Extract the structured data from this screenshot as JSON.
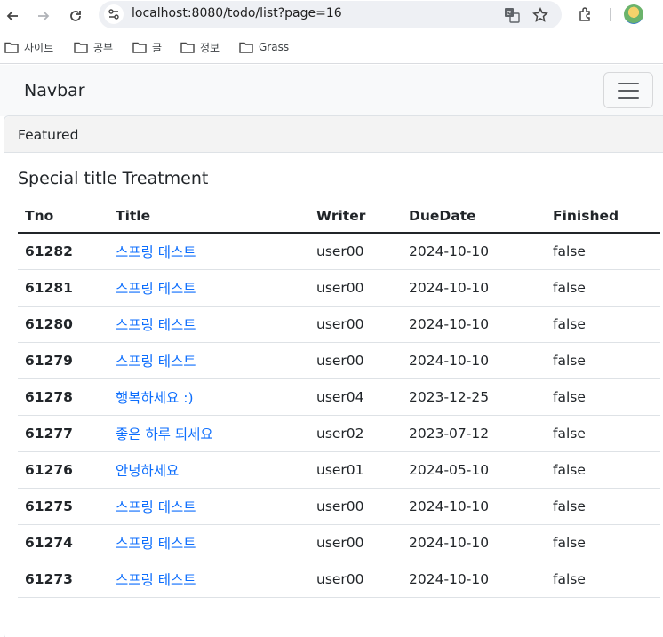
{
  "browser": {
    "url": "localhost:8080/todo/list?page=16"
  },
  "bookmarks": [
    {
      "label": "사이트"
    },
    {
      "label": "공부"
    },
    {
      "label": "글"
    },
    {
      "label": "정보"
    },
    {
      "label": "Grass"
    }
  ],
  "navbar": {
    "brand": "Navbar"
  },
  "card": {
    "header": "Featured",
    "title": "Special title Treatment"
  },
  "table": {
    "columns": [
      "Tno",
      "Title",
      "Writer",
      "DueDate",
      "Finished"
    ],
    "rows": [
      {
        "tno": "61282",
        "title": "스프링 테스트",
        "writer": "user00",
        "due": "2024-10-10",
        "finished": "false"
      },
      {
        "tno": "61281",
        "title": "스프링 테스트",
        "writer": "user00",
        "due": "2024-10-10",
        "finished": "false"
      },
      {
        "tno": "61280",
        "title": "스프링 테스트",
        "writer": "user00",
        "due": "2024-10-10",
        "finished": "false"
      },
      {
        "tno": "61279",
        "title": "스프링 테스트",
        "writer": "user00",
        "due": "2024-10-10",
        "finished": "false"
      },
      {
        "tno": "61278",
        "title": "행복하세요 :)",
        "writer": "user04",
        "due": "2023-12-25",
        "finished": "false"
      },
      {
        "tno": "61277",
        "title": "좋은 하루 되세요",
        "writer": "user02",
        "due": "2023-07-12",
        "finished": "false"
      },
      {
        "tno": "61276",
        "title": "안녕하세요",
        "writer": "user01",
        "due": "2024-05-10",
        "finished": "false"
      },
      {
        "tno": "61275",
        "title": "스프링 테스트",
        "writer": "user00",
        "due": "2024-10-10",
        "finished": "false"
      },
      {
        "tno": "61274",
        "title": "스프링 테스트",
        "writer": "user00",
        "due": "2024-10-10",
        "finished": "false"
      },
      {
        "tno": "61273",
        "title": "스프링 테스트",
        "writer": "user00",
        "due": "2024-10-10",
        "finished": "false"
      }
    ]
  },
  "colors": {
    "link": "#0d6efd",
    "navbar_bg": "#f8f9fa",
    "card_header_bg": "#f3f3f3"
  }
}
